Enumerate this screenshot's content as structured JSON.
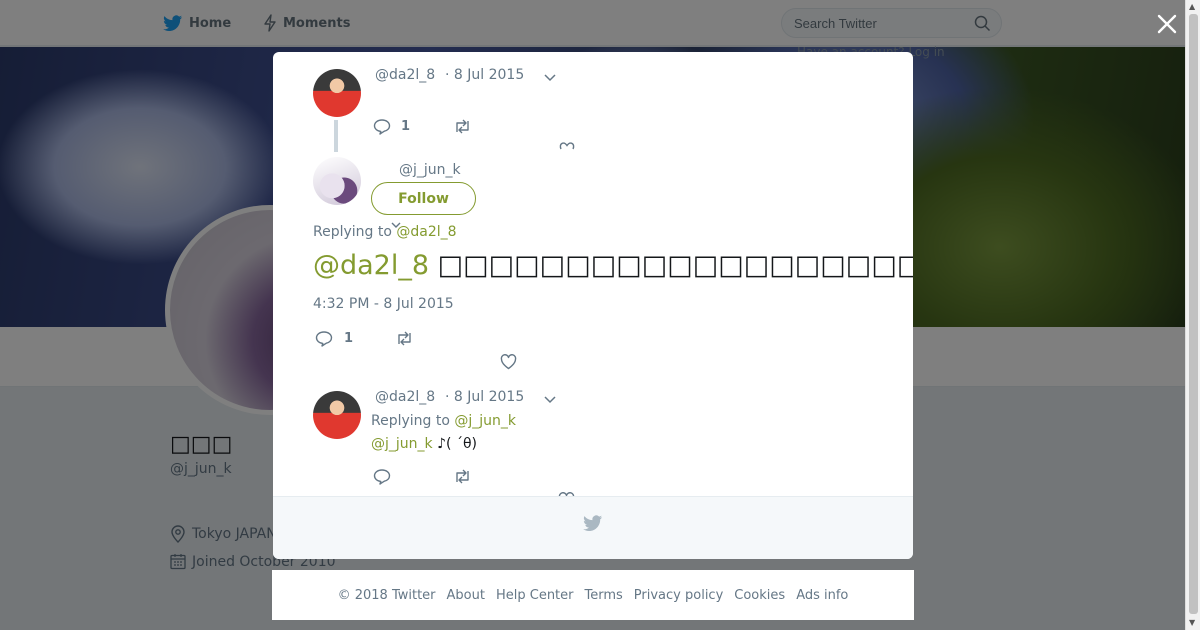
{
  "nav": {
    "home_label": "Home",
    "moments_label": "Moments",
    "search_placeholder": "Search Twitter",
    "login_hint": "Have an account? Log in"
  },
  "profile": {
    "name": "□□□",
    "handle": "@j_jun_k",
    "location": "Tokyo JAPAN",
    "joined": "Joined October 2010"
  },
  "modal": {
    "tweet1": {
      "handle": "@da2l_8",
      "date": "· 8 Jul 2015",
      "reply_count": "1"
    },
    "main_tweet": {
      "handle": "@j_jun_k",
      "follow_label": "Follow",
      "replying_to_label": "Replying to",
      "replying_to_handle": "@da2l_8",
      "mention": "@da2l_8",
      "text": "□□□□□□□□□□□□□□□□□□□□□□♪",
      "timestamp": "4:32 PM - 8 Jul 2015",
      "reply_count": "1"
    },
    "tweet3": {
      "handle": "@da2l_8",
      "date": "· 8 Jul 2015",
      "replying_to_label": "Replying to",
      "replying_to_handle": "@j_jun_k",
      "mention": "@j_jun_k",
      "text": "♪( ´θ)"
    }
  },
  "footer": {
    "links": [
      "© 2018 Twitter",
      "About",
      "Help Center",
      "Terms",
      "Privacy policy",
      "Cookies",
      "Ads info"
    ]
  },
  "colors": {
    "accent": "#849b30",
    "twitter_blue": "#1da1f2",
    "muted": "#657786"
  },
  "icons": [
    "twitter-bird-icon",
    "bolt-icon",
    "search-icon",
    "close-icon",
    "reply-icon",
    "retweet-icon",
    "heart-icon",
    "chevron-down-icon",
    "location-icon",
    "calendar-icon"
  ]
}
